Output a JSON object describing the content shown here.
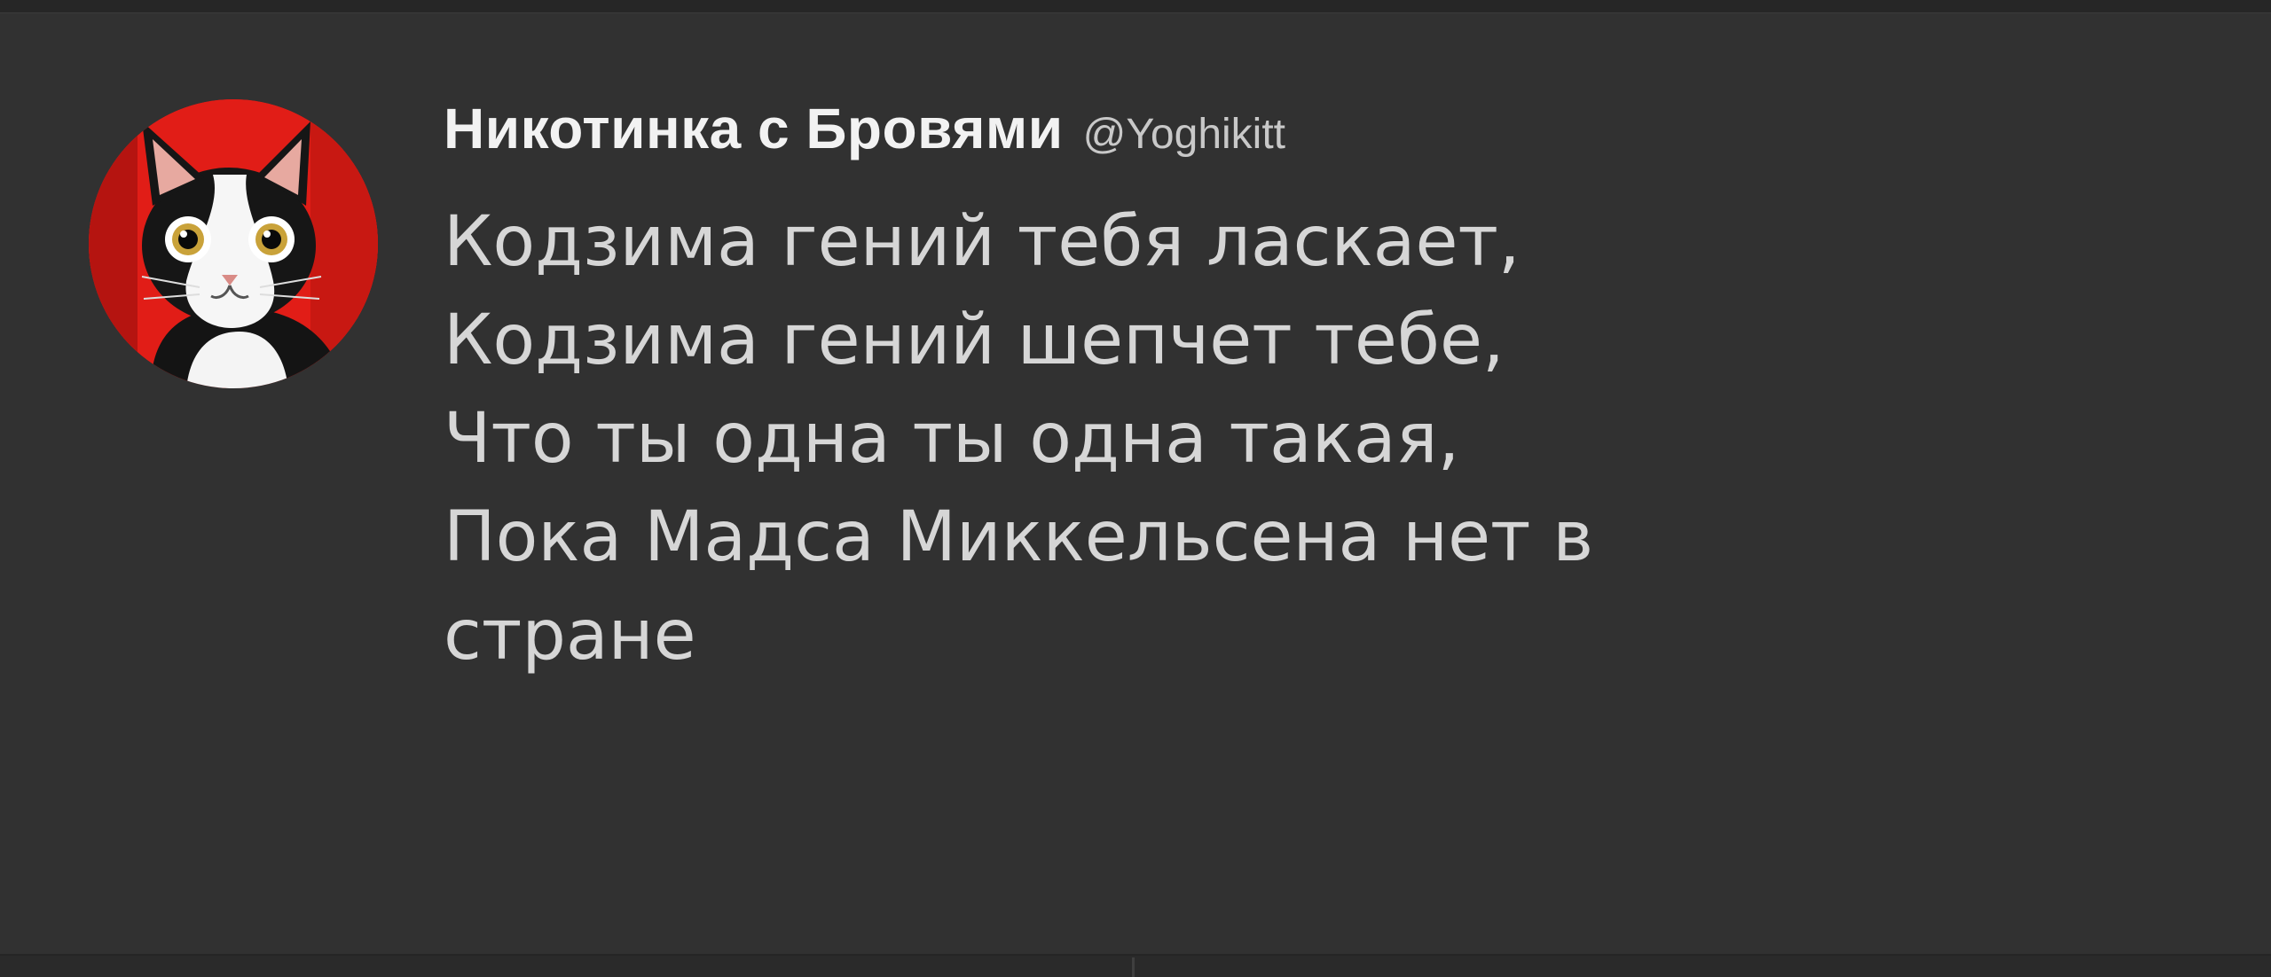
{
  "tweet": {
    "author": {
      "display_name": "Никотинка с Бровями",
      "handle": "@Yoghikitt",
      "avatar_icon": "cat-avatar-icon"
    },
    "lines": [
      "Кодзима гений тебя ласкает,",
      "Кодзима гений шепчет тебе,",
      "Что ты одна ты одна такая,",
      "Пока Мадса Миккельсена нет в",
      "стране"
    ]
  },
  "colors": {
    "background": "#313131",
    "name": "#f2f2f2",
    "handle": "#c8c8c8",
    "text": "#d6d6d6",
    "avatar_background": "#e11d17"
  }
}
